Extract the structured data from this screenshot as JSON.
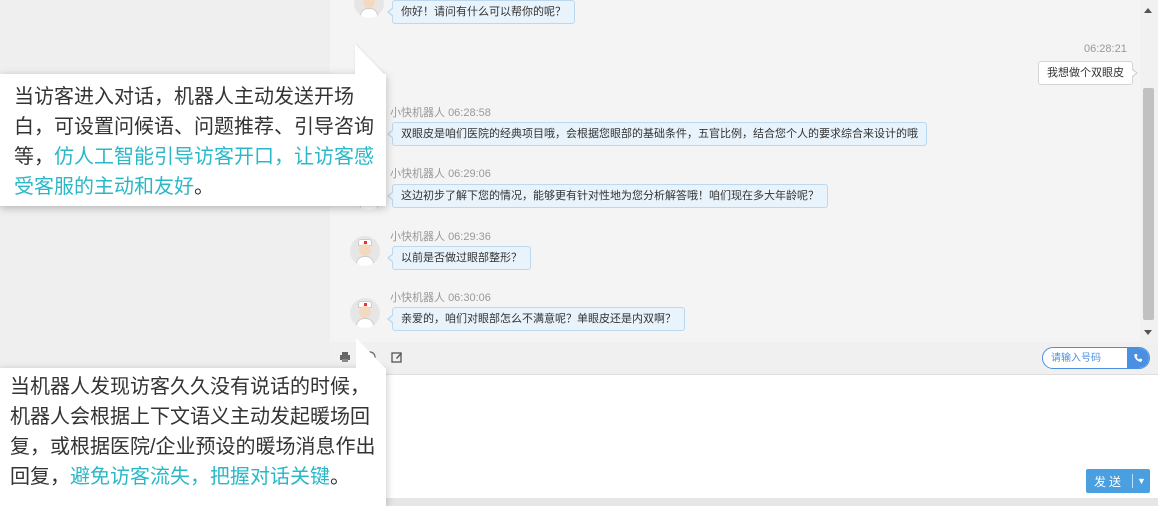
{
  "chat": {
    "messages": [
      {
        "sender": "",
        "time": "",
        "text": "你好！请问有什么可以帮你的呢？"
      },
      {
        "sender": "",
        "time": "06:28:21",
        "text": "我想做个双眼皮"
      },
      {
        "sender": "小快机器人",
        "time": "06:28:58",
        "text": "双眼皮是咱们医院的经典项目哦，会根据您眼部的基础条件，五官比例，结合您个人的要求综合来设计的哦"
      },
      {
        "sender": "小快机器人",
        "time": "06:29:06",
        "text": "这边初步了解下您的情况，能够更有针对性地为您分析解答哦！咱们现在多大年龄呢？"
      },
      {
        "sender": "小快机器人",
        "time": "06:29:36",
        "text": "以前是否做过眼部整形？"
      },
      {
        "sender": "小快机器人",
        "time": "06:30:06",
        "text": "亲爱的，咱们对眼部怎么不满意呢？单眼皮还是内双啊？"
      }
    ]
  },
  "toolbar": {
    "icons": [
      "printer-icon",
      "emoji-icon",
      "edit-icon"
    ],
    "phone_placeholder": "请输入号码",
    "phone_icon": "phone-icon"
  },
  "composer": {
    "send_label": "发送"
  },
  "callouts": {
    "first": {
      "normal": "当访客进入对话，机器人主动发送开场白，可设置问候语、问题推荐、引导咨询等，",
      "highlight": "仿人工智能引导访客开口，让访客感受客服的主动和友好",
      "tail": "。"
    },
    "second": {
      "normal": "当机器人发现访客久久没有说话的时候，机器人会根据上下文语义主动发起暖场回复，或根据医院/企业预设的暖场消息作出回复，",
      "highlight": "避免访客流失，把握对话关键",
      "tail": "。"
    }
  },
  "colors": {
    "accent": "#4a9fe0",
    "highlight_text": "#2ab8c8",
    "bot_bubble": "#e8f3fb"
  }
}
